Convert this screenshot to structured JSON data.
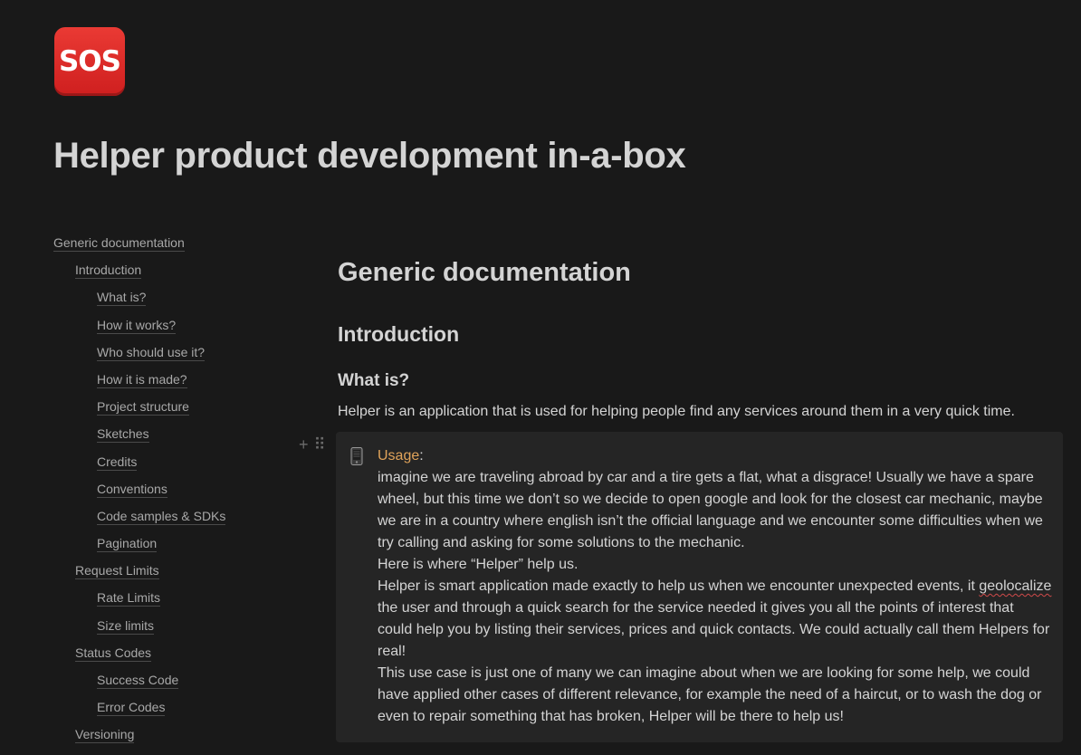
{
  "header": {
    "icon_label": "SOS",
    "title": "Helper product development in-a-box"
  },
  "toc": [
    {
      "label": "Generic documentation",
      "level": 0
    },
    {
      "label": "Introduction",
      "level": 1
    },
    {
      "label": "What is?",
      "level": 2
    },
    {
      "label": "How it works?",
      "level": 2
    },
    {
      "label": "Who should use it?",
      "level": 2
    },
    {
      "label": "How it is made?",
      "level": 2
    },
    {
      "label": "Project structure",
      "level": 2
    },
    {
      "label": "Sketches",
      "level": 2
    },
    {
      "label": "Credits",
      "level": 2
    },
    {
      "label": "Conventions",
      "level": 2
    },
    {
      "label": "Code samples & SDKs",
      "level": 2
    },
    {
      "label": "Pagination",
      "level": 2
    },
    {
      "label": "Request Limits",
      "level": 1
    },
    {
      "label": "Rate Limits",
      "level": 2
    },
    {
      "label": "Size limits",
      "level": 2
    },
    {
      "label": "Status Codes",
      "level": 1
    },
    {
      "label": "Success Code",
      "level": 2
    },
    {
      "label": "Error Codes",
      "level": 2
    },
    {
      "label": "Versioning",
      "level": 1
    }
  ],
  "content": {
    "h1": "Generic documentation",
    "h2": "Introduction",
    "h3": "What is?",
    "intro": "Helper is an application that is used for helping people find any services around them in a very quick time.",
    "callout": {
      "icon": "mobile-phone-icon",
      "label": "Usage",
      "label_suffix": ":",
      "p1": "imagine we are traveling abroad by car and a tire gets a flat, what a disgrace! Usually we have a spare wheel, but this time we don’t so we decide to open google and look for the closest car mechanic, maybe we are in a country where english isn’t the official language and we encounter some difficulties when we try calling and asking for some solutions to the mechanic.",
      "p2": "Here is where “Helper” help us.",
      "p3_start": "Helper is smart application made exactly to help us when we encounter unexpected events, it",
      "p3_misspelled": "geolocalize",
      "p3_end": " the user and through a quick search for the service needed it gives you all the points of interest that could help you by listing their services, prices and quick contacts. We could actually call them Helpers for real!",
      "p4": "This use case is just one of many we can imagine about when we are looking for some help, we could have applied other cases of different relevance, for example the need of a haircut, or to wash the dog or even to repair something that has broken, Helper will be there to help us!"
    }
  },
  "colors": {
    "background": "#191919",
    "text": "#d4d4d4",
    "toc_text": "#a8a8a8",
    "callout_bg": "#252525",
    "usage_accent": "#e0a35a",
    "sos_red": "#e02b2b"
  }
}
